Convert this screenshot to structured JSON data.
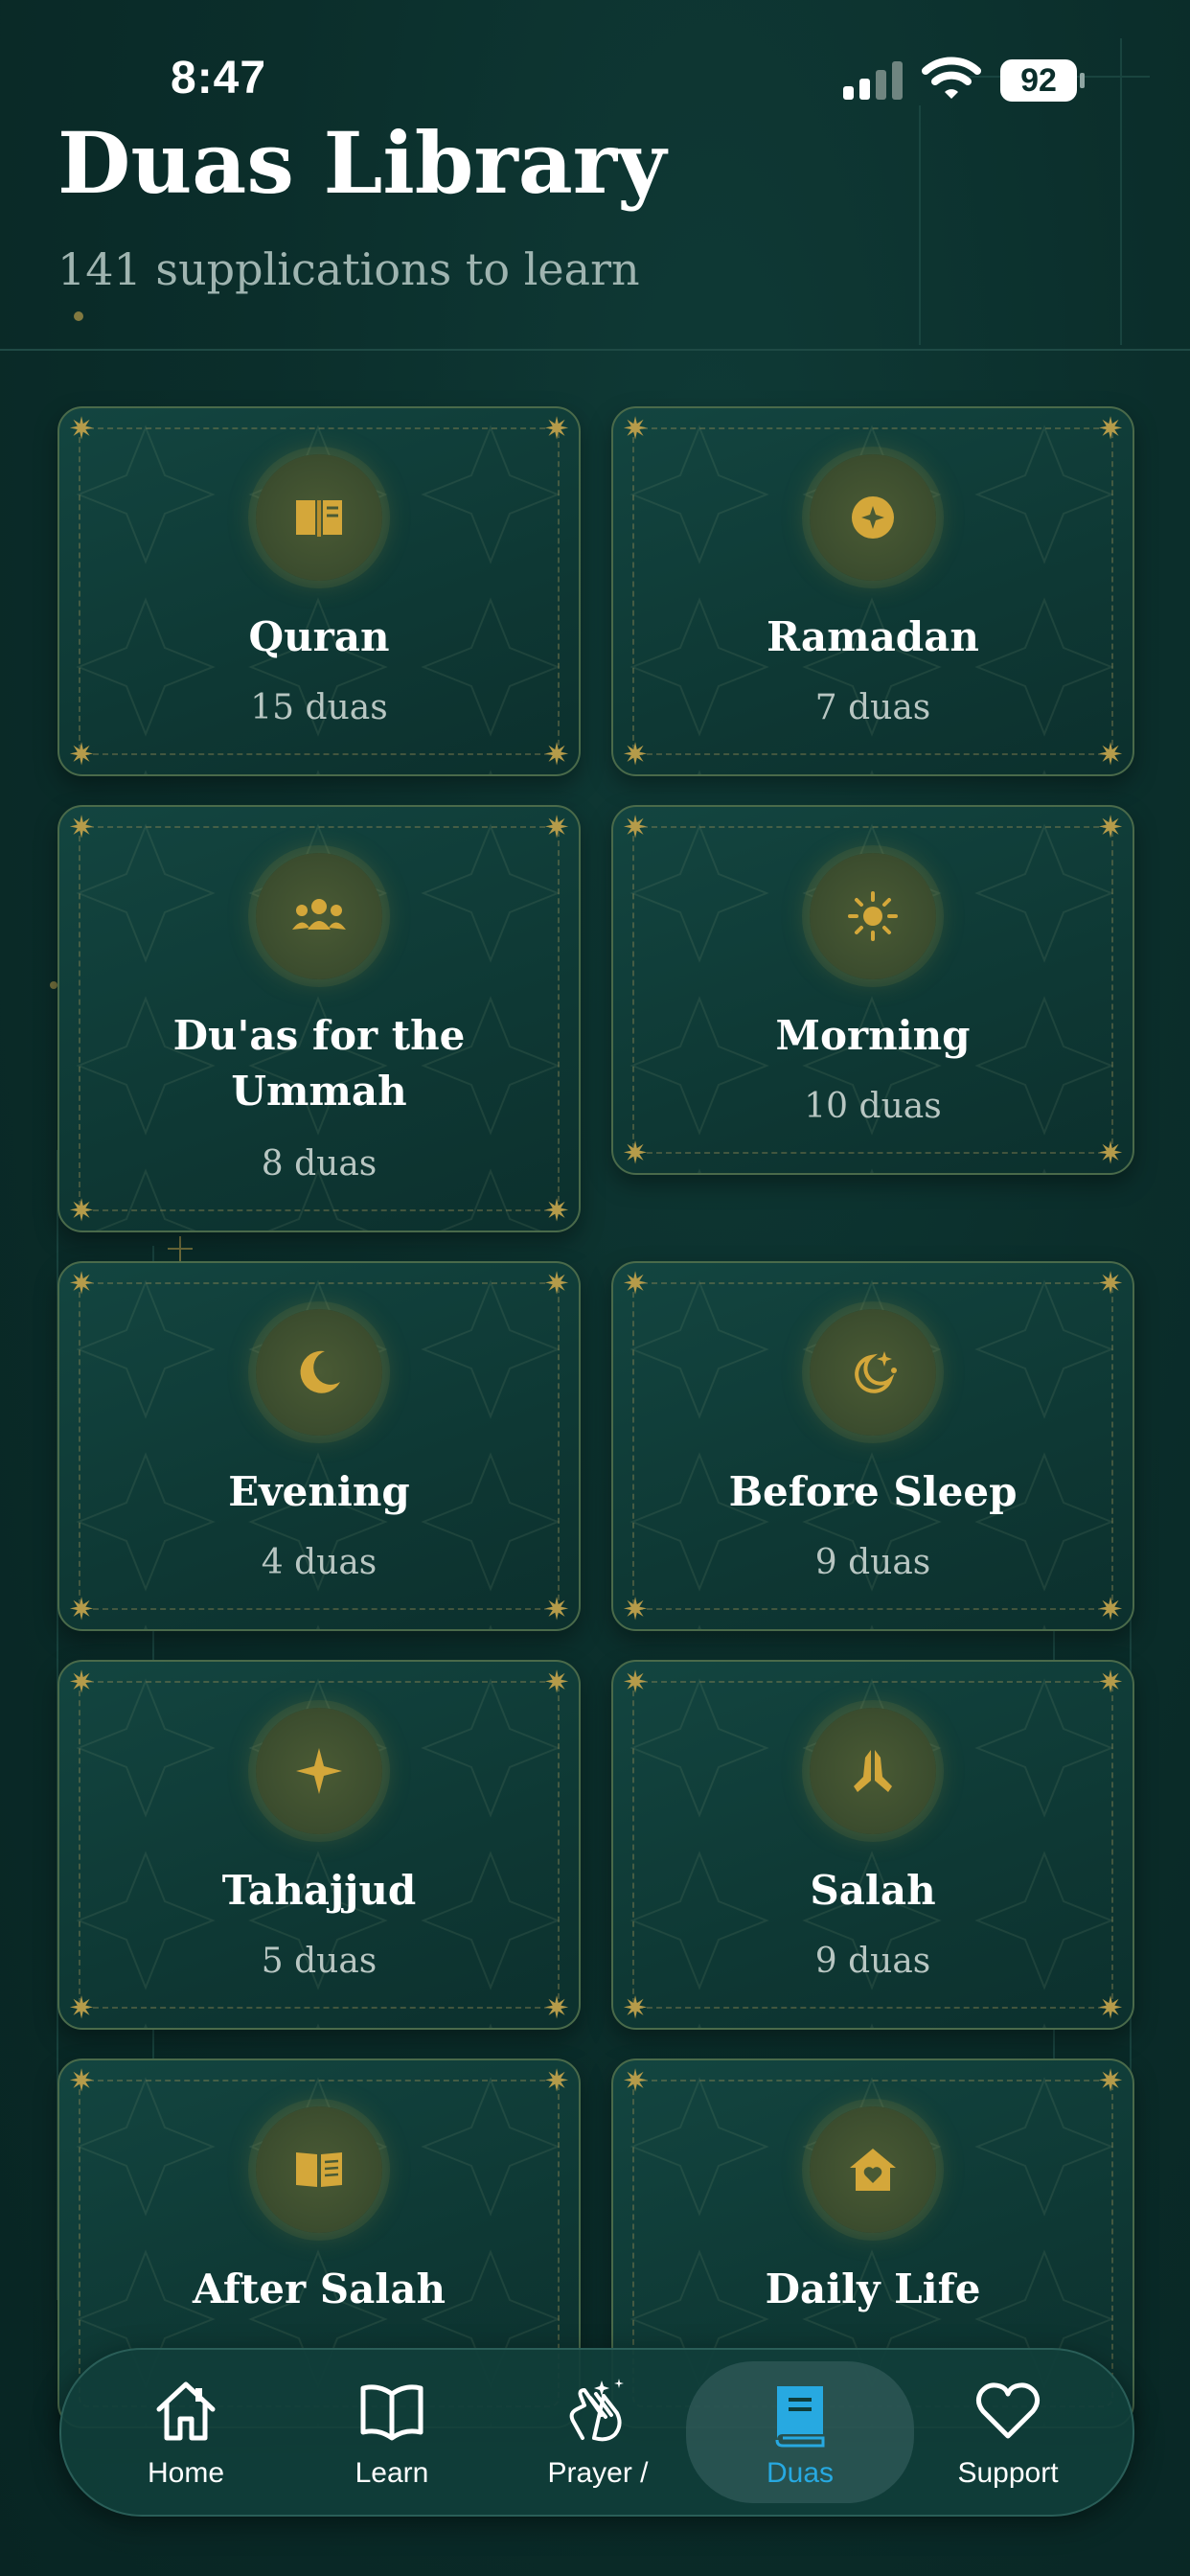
{
  "status_bar": {
    "time": "8:47",
    "battery": "92"
  },
  "header": {
    "title": "Duas Library",
    "subtitle": "141 supplications to learn"
  },
  "categories": [
    {
      "title": "Quran",
      "count": "15 duas",
      "icon": "book-icon"
    },
    {
      "title": "Ramadan",
      "count": "7 duas",
      "icon": "sparkle-icon"
    },
    {
      "title_line1": "Du'as for the",
      "title_line2": "Ummah",
      "count": "8 duas",
      "icon": "group-icon"
    },
    {
      "title": "Morning",
      "count": "10 duas",
      "icon": "sun-icon"
    },
    {
      "title": "Evening",
      "count": "4 duas",
      "icon": "moon-icon"
    },
    {
      "title": "Before Sleep",
      "count": "9 duas",
      "icon": "moon-stars-icon"
    },
    {
      "title": "Tahajjud",
      "count": "5 duas",
      "icon": "star-icon"
    },
    {
      "title": "Salah",
      "count": "9 duas",
      "icon": "praying-hands-icon"
    },
    {
      "title": "After Salah",
      "icon": "open-book-icon"
    },
    {
      "title": "Daily Life",
      "icon": "home-heart-icon"
    }
  ],
  "tab_bar": {
    "tabs": [
      {
        "label": "Home",
        "icon": "home-icon"
      },
      {
        "label": "Learn",
        "icon": "open-book-icon"
      },
      {
        "label": "Prayer /",
        "icon": "clapping-hands-icon"
      },
      {
        "label": "Duas",
        "icon": "book-icon"
      },
      {
        "label": "Support",
        "icon": "heart-icon"
      }
    ],
    "active": "Duas"
  },
  "colors": {
    "background": "#0b2e2b",
    "gold": "#d4a73a",
    "active_tab": "#27a9e1"
  }
}
